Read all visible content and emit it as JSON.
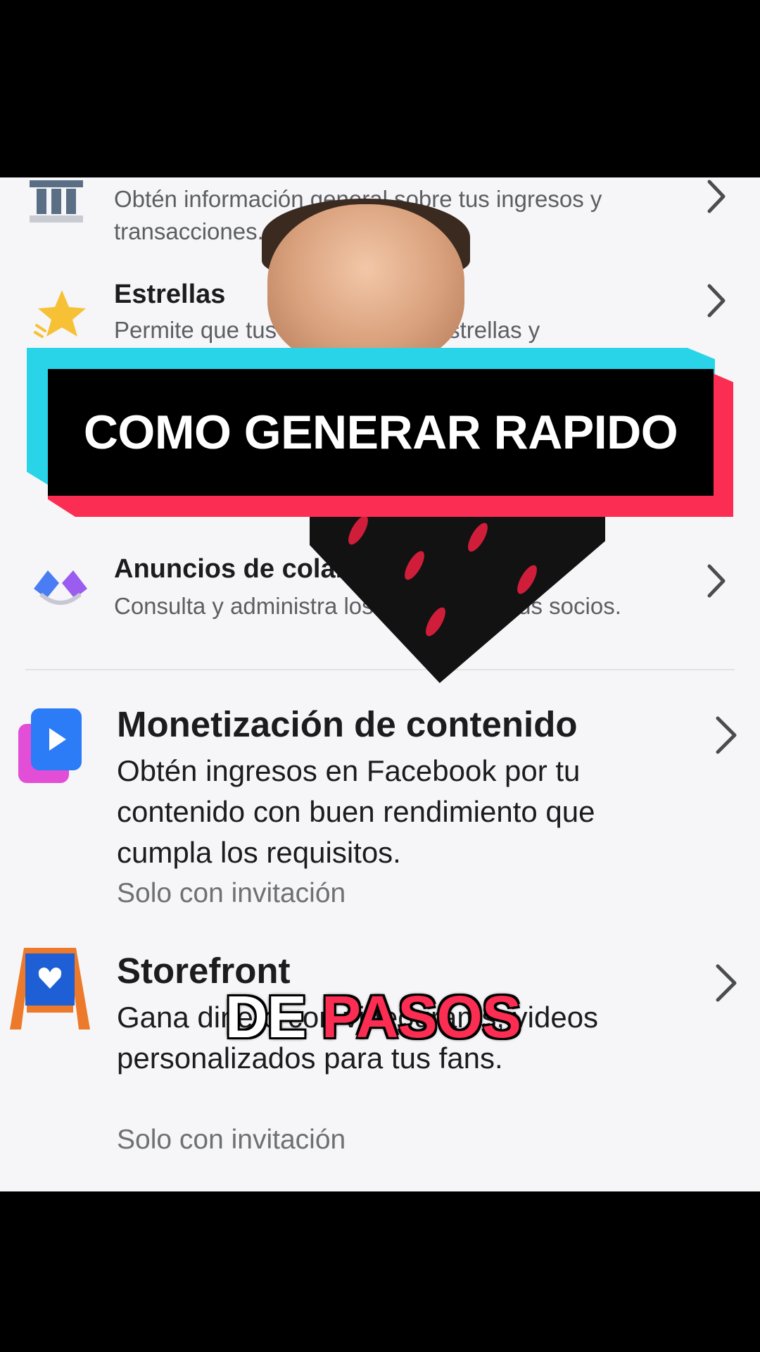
{
  "items": [
    {
      "title": "",
      "desc": "Obtén información general sobre tus ingresos y transacciones.",
      "icon": "bank-icon"
    },
    {
      "title": "Estrellas",
      "desc": "Permite que tus fans te envíen estrellas y",
      "icon": "star-icon"
    },
    {
      "title": "Anuncios de colaboración",
      "desc": "Consulta y administra los anuncios de tus socios.",
      "icon": "handshake-icon"
    },
    {
      "title": "Monetización de contenido",
      "desc": "Obtén ingresos en Facebook por tu contenido con buen rendimiento que cumpla los requisitos.",
      "meta": "Solo con invitación",
      "icon": "play-video-icon"
    },
    {
      "title": "Storefront",
      "desc": "Gana dinero con videograms, videos personalizados para tus fans.",
      "meta": "Solo con invitación",
      "icon": "storefront-icon"
    }
  ],
  "overlay": {
    "banner": "COMO GENERAR RAPIDO",
    "caption_word1": "DE",
    "caption_word2": "PASOS"
  },
  "colors": {
    "cyan": "#29d4e8",
    "red": "#fb2d52",
    "text": "#1c1c1e"
  }
}
